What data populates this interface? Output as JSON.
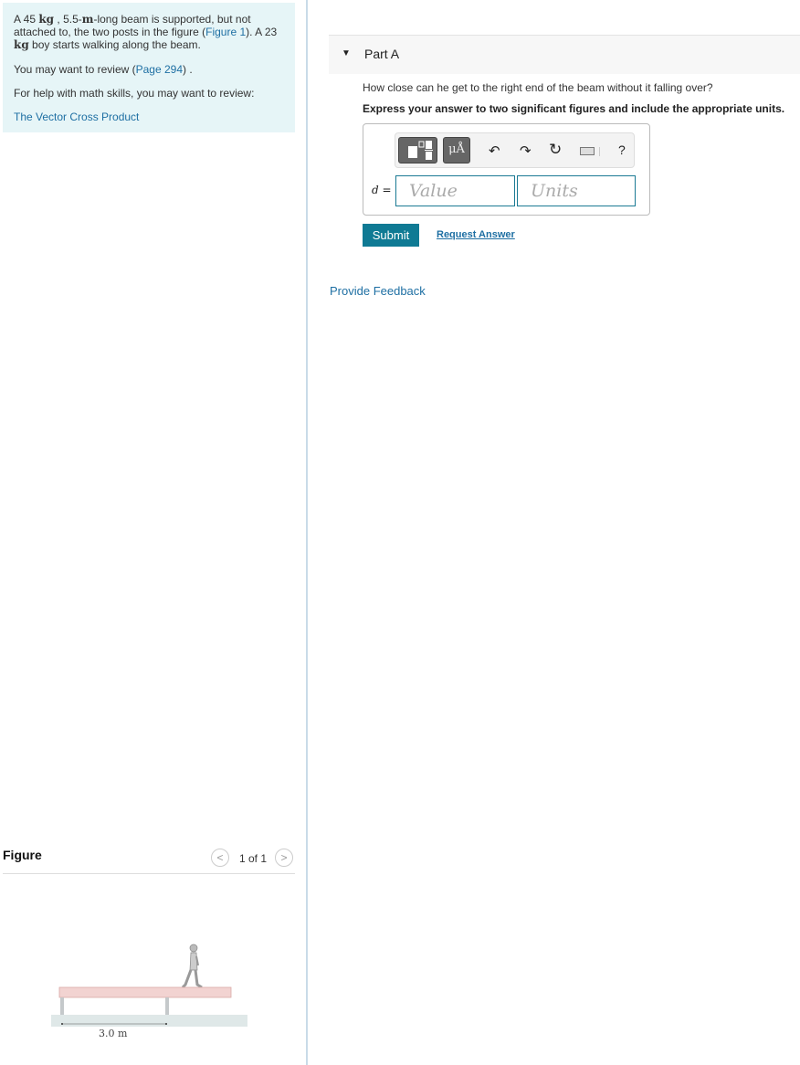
{
  "problem": {
    "t1": "A 45 ",
    "u1": "kg",
    "t2": " , 5.5-",
    "u2": "m",
    "t3": "-long beam is supported, but not attached to, the two posts in the figure (",
    "figure_link": "Figure 1",
    "t4": "). A 23 ",
    "u3": "kg",
    "t5": " boy starts walking along the beam.",
    "review_prefix": "You may want to review (",
    "review_link": "Page 294",
    "review_suffix": ") .",
    "math_help": "For help with math skills, you may want to review:",
    "math_link": "The Vector Cross Product"
  },
  "figure": {
    "header": "Figure",
    "pager": "1 of 1",
    "prev_icon": "chevron-left-icon",
    "next_icon": "chevron-right-icon",
    "dimension_label": "3.0 m"
  },
  "part": {
    "title": "Part A",
    "question": "How close can he get to the right end of the beam without it falling over?",
    "instruction": "Express your answer to two significant figures and include the appropriate units.",
    "variable": "d",
    "equals": " =",
    "value_placeholder": "Value",
    "units_placeholder": "Units",
    "units_tool_label": "μÅ",
    "help": "?",
    "submit": "Submit",
    "request_answer": "Request Answer"
  },
  "feedback": "Provide Feedback",
  "colors": {
    "accent": "#0f7a94",
    "link": "#1e6fa3",
    "problem_bg": "#e6f5f7"
  }
}
